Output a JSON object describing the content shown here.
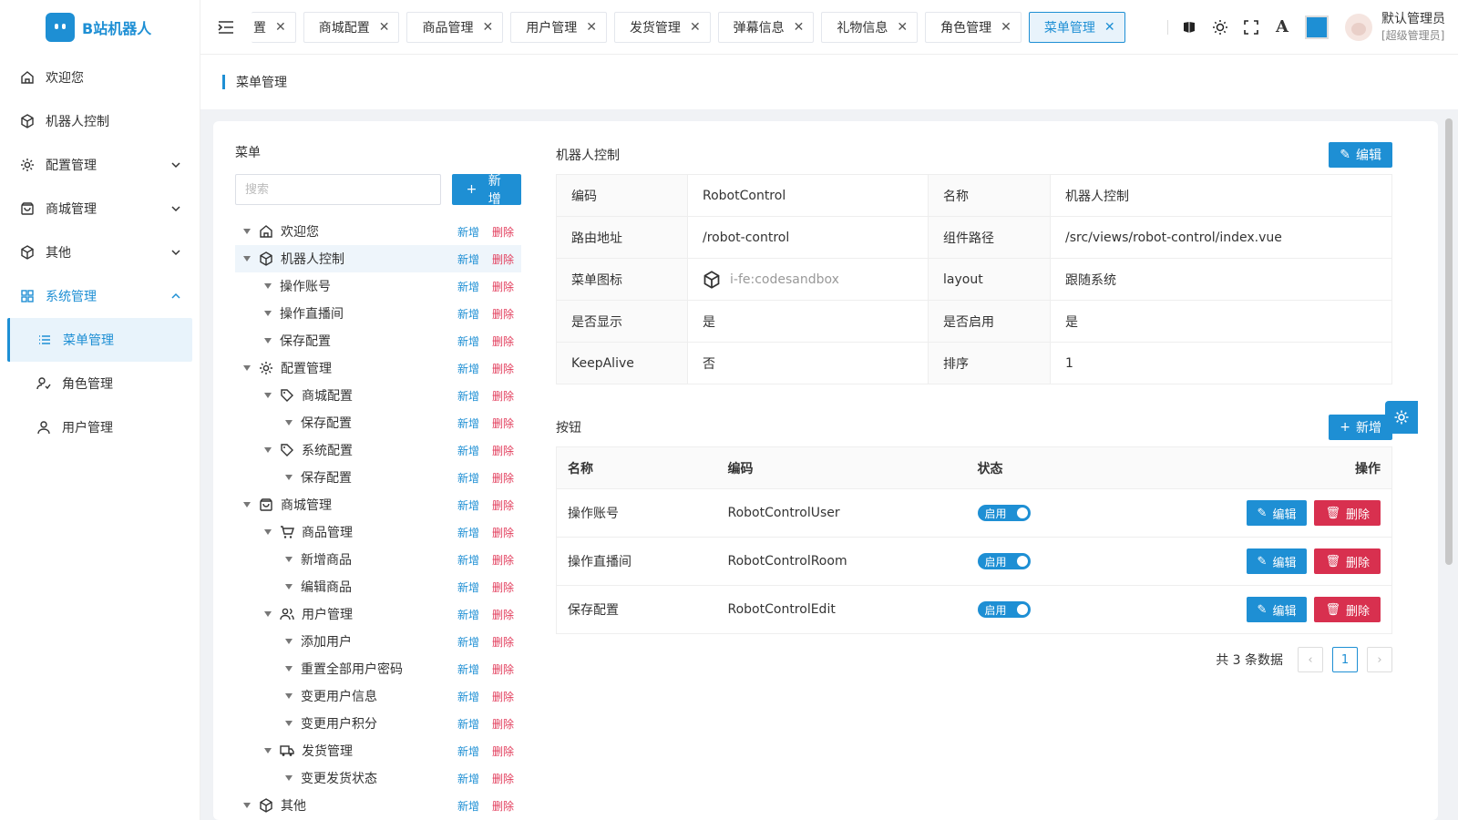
{
  "app": {
    "title": "B站机器人"
  },
  "sidebar": {
    "items": [
      {
        "label": "欢迎您",
        "icon": "home-icon"
      },
      {
        "label": "机器人控制",
        "icon": "cube-icon"
      },
      {
        "label": "配置管理",
        "icon": "gear-icon",
        "expandable": true
      },
      {
        "label": "商城管理",
        "icon": "shopping-bag-icon",
        "expandable": true
      },
      {
        "label": "其他",
        "icon": "cube-icon",
        "expandable": true
      },
      {
        "label": "系统管理",
        "icon": "grid-icon",
        "expandable": true,
        "expanded": true
      }
    ],
    "submenu": [
      {
        "label": "菜单管理",
        "icon": "list-icon",
        "active": true
      },
      {
        "label": "角色管理",
        "icon": "user-check-icon"
      },
      {
        "label": "用户管理",
        "icon": "user-icon"
      }
    ]
  },
  "header": {
    "tabs": [
      {
        "label": "置",
        "partial": true
      },
      {
        "label": "商城配置"
      },
      {
        "label": "商品管理"
      },
      {
        "label": "用户管理"
      },
      {
        "label": "发货管理"
      },
      {
        "label": "弹幕信息"
      },
      {
        "label": "礼物信息"
      },
      {
        "label": "角色管理"
      },
      {
        "label": "菜单管理",
        "active": true
      }
    ],
    "theme_color": "#1e8fd4",
    "font_tool": "A",
    "user": {
      "name": "默认管理员",
      "role": "[超级管理员]"
    }
  },
  "page": {
    "title": "菜单管理"
  },
  "tree_panel": {
    "title": "菜单",
    "search_placeholder": "搜索",
    "add_label": "新增",
    "node_add": "新增",
    "node_del": "删除",
    "nodes": [
      {
        "label": "欢迎您",
        "level": 0,
        "icon": "home-icon"
      },
      {
        "label": "机器人控制",
        "level": 0,
        "icon": "cube-icon",
        "selected": true
      },
      {
        "label": "操作账号",
        "level": 1
      },
      {
        "label": "操作直播间",
        "level": 1
      },
      {
        "label": "保存配置",
        "level": 1
      },
      {
        "label": "配置管理",
        "level": 0,
        "icon": "gear-icon"
      },
      {
        "label": "商城配置",
        "level": 1,
        "icon": "tag-icon"
      },
      {
        "label": "保存配置",
        "level": 2
      },
      {
        "label": "系统配置",
        "level": 1,
        "icon": "tag-icon"
      },
      {
        "label": "保存配置",
        "level": 2
      },
      {
        "label": "商城管理",
        "level": 0,
        "icon": "shopping-bag-icon"
      },
      {
        "label": "商品管理",
        "level": 1,
        "icon": "cart-icon"
      },
      {
        "label": "新增商品",
        "level": 2
      },
      {
        "label": "编辑商品",
        "level": 2
      },
      {
        "label": "用户管理",
        "level": 1,
        "icon": "users-icon"
      },
      {
        "label": "添加用户",
        "level": 2
      },
      {
        "label": "重置全部用户密码",
        "level": 2
      },
      {
        "label": "变更用户信息",
        "level": 2
      },
      {
        "label": "变更用户积分",
        "level": 2
      },
      {
        "label": "发货管理",
        "level": 1,
        "icon": "truck-icon"
      },
      {
        "label": "变更发货状态",
        "level": 2
      },
      {
        "label": "其他",
        "level": 0,
        "icon": "cube-icon"
      }
    ]
  },
  "detail": {
    "title": "机器人控制",
    "edit_label": "编辑",
    "rows": [
      {
        "k1": "编码",
        "v1": "RobotControl",
        "k2": "名称",
        "v2": "机器人控制"
      },
      {
        "k1": "路由地址",
        "v1": "/robot-control",
        "k2": "组件路径",
        "v2": "/src/views/robot-control/index.vue"
      },
      {
        "k1": "菜单图标",
        "v1": "i-fe:codesandbox",
        "k2": "layout",
        "v2": "跟随系统"
      },
      {
        "k1": "是否显示",
        "v1": "是",
        "k2": "是否启用",
        "v2": "是"
      },
      {
        "k1": "KeepAlive",
        "v1": "否",
        "k2": "排序",
        "v2": "1"
      }
    ]
  },
  "buttons_section": {
    "title": "按钮",
    "add_label": "新增",
    "columns": [
      "名称",
      "编码",
      "状态",
      "操作"
    ],
    "rows": [
      {
        "name": "操作账号",
        "code": "RobotControlUser",
        "status": "启用"
      },
      {
        "name": "操作直播间",
        "code": "RobotControlRoom",
        "status": "启用"
      },
      {
        "name": "保存配置",
        "code": "RobotControlEdit",
        "status": "启用"
      }
    ],
    "edit_label": "编辑",
    "delete_label": "删除",
    "total_text": "共 3 条数据",
    "current_page": "1",
    "prev": "‹",
    "next": "›"
  }
}
